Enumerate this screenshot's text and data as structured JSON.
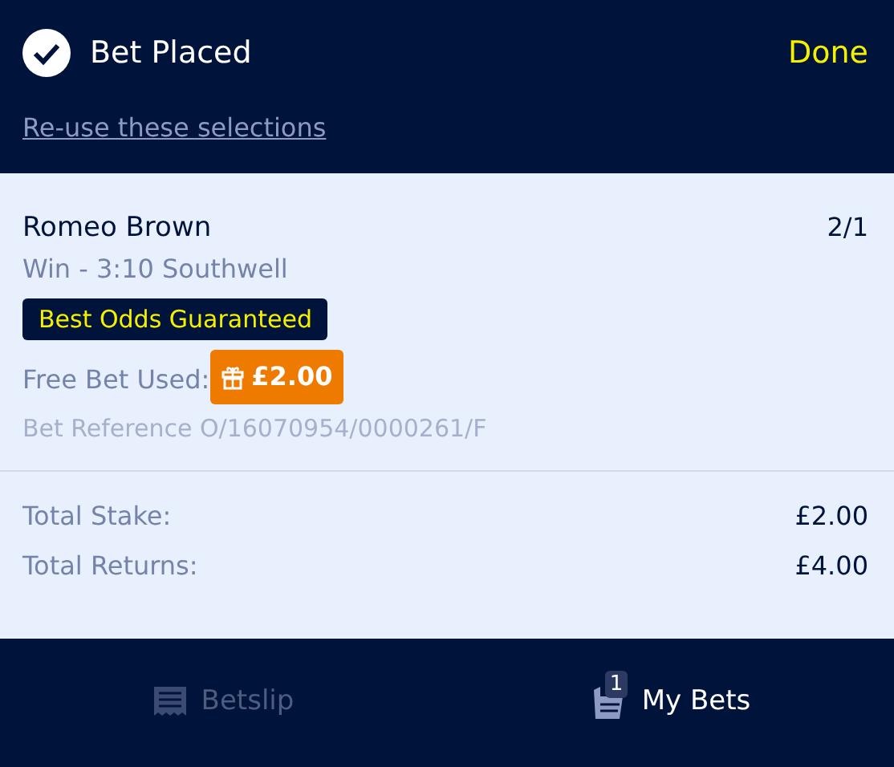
{
  "header": {
    "title": "Bet Placed",
    "done": "Done",
    "reuse_link": "Re-use these selections"
  },
  "bet": {
    "selection": "Romeo Brown",
    "odds": "2/1",
    "market": "Win - 3:10 Southwell",
    "badge": "Best Odds Guaranteed",
    "free_bet_label": "Free Bet Used:",
    "free_bet_amount": "£2.00",
    "reference": "Bet Reference O/16070954/0000261/F"
  },
  "totals": [
    {
      "label": "Total Stake:",
      "value": "£2.00"
    },
    {
      "label": "Total Returns:",
      "value": "£4.00"
    }
  ],
  "tabs": [
    {
      "kind": "betslip",
      "label": "Betslip",
      "selected": false
    },
    {
      "kind": "mybets",
      "label": "My Bets",
      "selected": true,
      "count": "1"
    }
  ]
}
